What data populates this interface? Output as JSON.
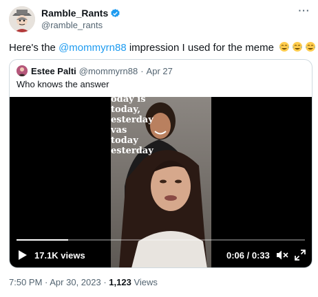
{
  "author": {
    "name": "Ramble_Rants",
    "handle": "@ramble_rants",
    "verified": true
  },
  "tweet": {
    "text_before": "Here's the ",
    "mention": "@mommyrn88",
    "text_after": " impression I used for the meme",
    "emoji": [
      "face-with-tears-of-joy",
      "face-with-tears-of-joy",
      "face-with-tears-of-joy"
    ]
  },
  "quoted": {
    "name": "Estee Palti",
    "handle": "@mommyrn88",
    "separator": "·",
    "date": "Apr 27",
    "text": "Who knows the answer",
    "video_caption": [
      "oday is",
      "today,",
      "esterday",
      "vas today",
      "esterday"
    ],
    "video": {
      "views": "17.1K views",
      "time": "0:06 / 0:33",
      "progress": 0.18
    }
  },
  "footer": {
    "time": "7:50 PM",
    "sep1": " · ",
    "date": "Apr 30, 2023",
    "sep2": " · ",
    "views_count": "1,123",
    "views_label": " Views"
  },
  "colors": {
    "link": "#1d9bf0",
    "verified": "#1d9bf0",
    "muted": "#536471",
    "border": "#cfd9de"
  }
}
